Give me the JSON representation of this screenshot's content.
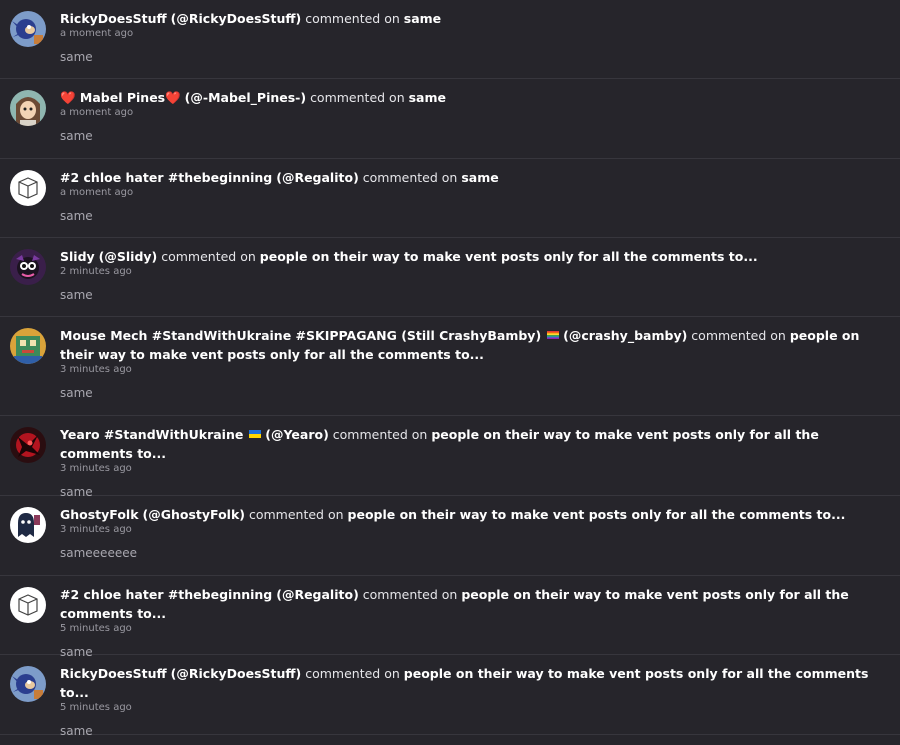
{
  "comments": [
    {
      "name": "RickyDoesStuff",
      "handle": "(@RickyDoesStuff)",
      "action": "commented on",
      "target": "same",
      "time": "a moment ago",
      "text": "same"
    },
    {
      "name": "❤️ Mabel Pines❤️",
      "handle": "(@-Mabel_Pines-)",
      "action": "commented on",
      "target": "same",
      "time": "a moment ago",
      "text": "same"
    },
    {
      "name": "#2 chloe hater #thebeginning",
      "handle": "(@Regalito)",
      "action": "commented on",
      "target": "same",
      "time": "a moment ago",
      "text": "same"
    },
    {
      "name": "Slidy",
      "handle": "(@Slidy)",
      "action": "commented on",
      "target": "people on their way to make vent posts only for all the comments to...",
      "time": "2 minutes ago",
      "text": "same"
    },
    {
      "name": "Mouse Mech #StandWithUkraine #SKIPPAGANG (Still CrashyBamby)",
      "handle": "(@crashy_bamby)",
      "action": "commented on",
      "target": "people on their way to make vent posts only for all the comments to...",
      "time": "3 minutes ago",
      "text": "same"
    },
    {
      "name": "Yearo #StandWithUkraine",
      "handle": "(@Yearo)",
      "action": "commented on",
      "target": "people on their way to make vent posts only for all the comments to...",
      "time": "3 minutes ago",
      "text": "same"
    },
    {
      "name": "GhostyFolk",
      "handle": "(@GhostyFolk)",
      "action": "commented on",
      "target": "people on their way to make vent posts only for all the comments to...",
      "time": "3 minutes ago",
      "text": "sameeeeeee"
    },
    {
      "name": "#2 chloe hater #thebeginning",
      "handle": "(@Regalito)",
      "action": "commented on",
      "target": "people on their way to make vent posts only for all the comments to...",
      "time": "5 minutes ago",
      "text": "same"
    },
    {
      "name": "RickyDoesStuff",
      "handle": "(@RickyDoesStuff)",
      "action": "commented on",
      "target": "people on their way to make vent posts only for all the comments to...",
      "time": "5 minutes ago",
      "text": "same"
    }
  ],
  "colors": {
    "background": "#26252b",
    "divider": "#37363d",
    "timestamp": "#9a99a1",
    "body_text": "#a9a8b0"
  }
}
